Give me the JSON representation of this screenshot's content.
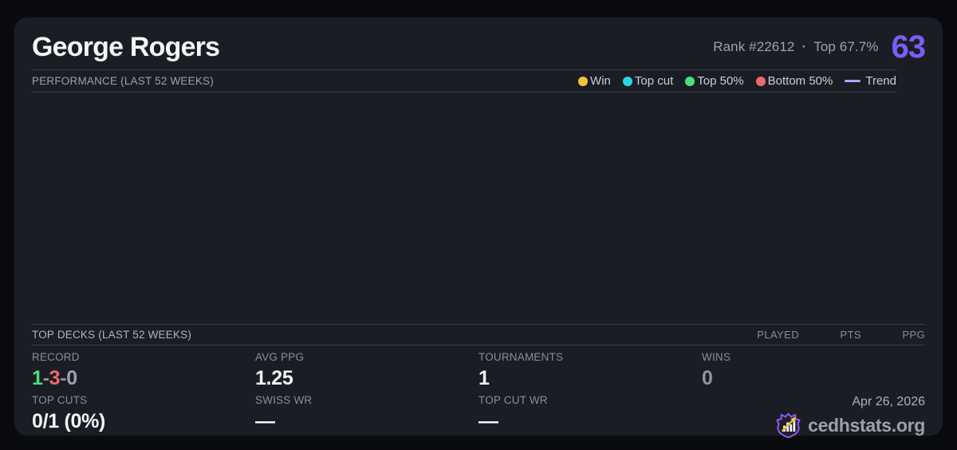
{
  "header": {
    "player_name": "George Rogers",
    "rank": "Rank #22612",
    "separator": "·",
    "top_percent": "Top 67.7%",
    "rating": "63",
    "rating_color": "#7d5cf6"
  },
  "performance": {
    "title": "PERFORMANCE (LAST 52 WEEKS)",
    "legend": [
      {
        "label": "Win",
        "color": "#f2c338",
        "marker": "dot"
      },
      {
        "label": "Top cut",
        "color": "#2bd4e4",
        "marker": "dot"
      },
      {
        "label": "Top 50%",
        "color": "#4ade80",
        "marker": "dot"
      },
      {
        "label": "Bottom 50%",
        "color": "#ee6b6b",
        "marker": "dot"
      },
      {
        "label": "Trend",
        "color": "#b4a1f8",
        "marker": "line"
      }
    ]
  },
  "chart_data": {
    "type": "scatter",
    "title": "Performance (last 52 weeks)",
    "x": [],
    "series": [
      {
        "name": "Win",
        "values": []
      },
      {
        "name": "Top cut",
        "values": []
      },
      {
        "name": "Top 50%",
        "values": []
      },
      {
        "name": "Bottom 50%",
        "values": []
      },
      {
        "name": "Trend",
        "values": []
      }
    ],
    "grid": false,
    "legend_position": "top-right",
    "note": "Chart plot area is empty in the screenshot - no data points rendered"
  },
  "top_decks": {
    "title": "TOP DECKS (LAST 52 WEEKS)",
    "columns": [
      "PLAYED",
      "PTS",
      "PPG"
    ],
    "rows": []
  },
  "stats": {
    "record": {
      "label": "RECORD",
      "parts": [
        {
          "text": "1",
          "color": "#4ade80"
        },
        {
          "text": "-",
          "color": "#8b919c"
        },
        {
          "text": "3",
          "color": "#ef6b6b"
        },
        {
          "text": "-",
          "color": "#8b919c"
        },
        {
          "text": "0",
          "color": "#9aa3b2"
        }
      ]
    },
    "avg_ppg": {
      "label": "AVG PPG",
      "value": "1.25"
    },
    "tournaments": {
      "label": "TOURNAMENTS",
      "value": "1"
    },
    "wins": {
      "label": "WINS",
      "value": "0",
      "value_color": "#8d96a3"
    },
    "top_cuts": {
      "label": "TOP CUTS",
      "value": "0/1 (0%)"
    },
    "swiss_wr": {
      "label": "SWISS WR",
      "value": "—"
    },
    "top_cut_wr": {
      "label": "TOP CUT WR",
      "value": "—"
    }
  },
  "footer": {
    "date": "Apr 26, 2026",
    "brand": "cedhstats.org"
  }
}
